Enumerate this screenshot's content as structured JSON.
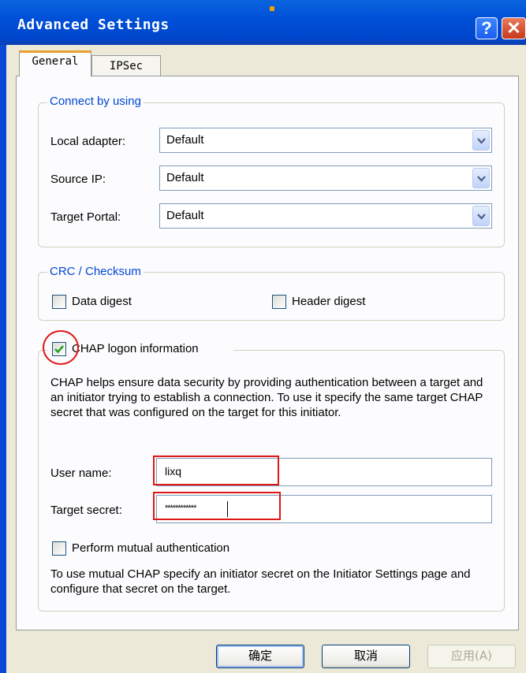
{
  "window": {
    "title": "Advanced Settings",
    "help_glyph": "?",
    "close_glyph": "✕"
  },
  "tabs": [
    {
      "label": "General"
    },
    {
      "label": "IPSec"
    }
  ],
  "connect": {
    "legend": "Connect by using",
    "local_adapter": {
      "label": "Local adapter:",
      "value": "Default"
    },
    "source_ip": {
      "label": "Source IP:",
      "value": "Default"
    },
    "target_portal": {
      "label": "Target Portal:",
      "value": "Default"
    }
  },
  "crc": {
    "legend": "CRC / Checksum",
    "data_digest": {
      "label": "Data digest",
      "checked": false
    },
    "header_digest": {
      "label": "Header digest",
      "checked": false
    }
  },
  "chap": {
    "label": "CHAP logon information",
    "checked": true,
    "description": "CHAP helps ensure data security by providing authentication between a target and an initiator trying to establish a connection. To use it specify the same target CHAP secret that was configured on the target for this initiator.",
    "user_name": {
      "label": "User name:",
      "value": "lixq"
    },
    "target_secret": {
      "label": "Target secret:",
      "value": "************"
    },
    "mutual": {
      "label": "Perform mutual authentication",
      "checked": false
    },
    "mutual_note": "To use mutual CHAP specify an initiator secret on the Initiator Settings page and configure that secret on the target."
  },
  "buttons": {
    "ok": "确定",
    "cancel": "取消",
    "apply": "应用(A)"
  },
  "colors": {
    "titlebar": "#0050d8",
    "annotation": "#e01818",
    "legend_text": "#0046d5",
    "dialog_bg": "#ece9d8"
  }
}
